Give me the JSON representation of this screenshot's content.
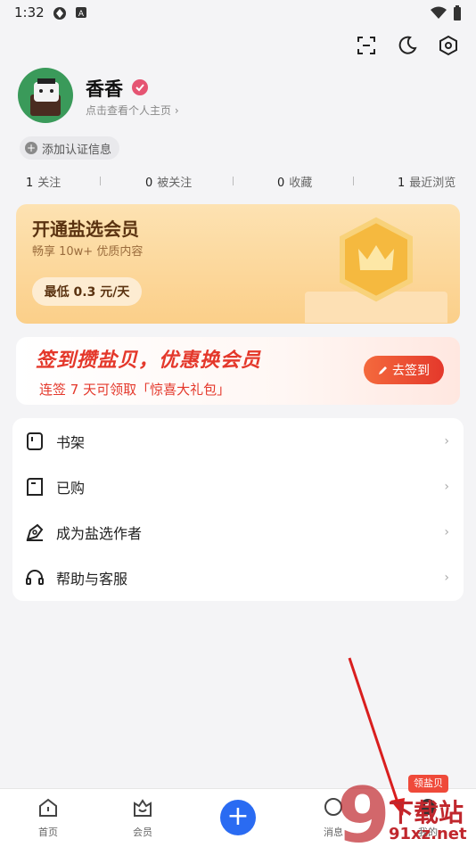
{
  "status_bar": {
    "time": "1:32"
  },
  "top_icons": [
    "scan-icon",
    "moon-icon",
    "settings-icon"
  ],
  "profile": {
    "name": "香香",
    "link_text": "点击查看个人主页 ›",
    "add_cert": "添加认证信息"
  },
  "stats": [
    {
      "num": "1",
      "label": "关注"
    },
    {
      "num": "0",
      "label": "被关注"
    },
    {
      "num": "0",
      "label": "收藏"
    },
    {
      "num": "1",
      "label": "最近浏览"
    }
  ],
  "vip": {
    "title": "开通盐选会员",
    "subtitle": "畅享 10w+ 优质内容",
    "button": "最低 0.3 元/天"
  },
  "checkin": {
    "title": "签到攒盐贝，优惠换会员",
    "subtitle": "连签 7 天可领取「惊喜大礼包」",
    "button": "去签到"
  },
  "menu": [
    {
      "label": "书架",
      "icon": "bookshelf-icon"
    },
    {
      "label": "已购",
      "icon": "purchased-icon"
    },
    {
      "label": "成为盐选作者",
      "icon": "pen-icon"
    },
    {
      "label": "帮助与客服",
      "icon": "headset-icon"
    }
  ],
  "tabbar": {
    "tabs": [
      {
        "label": "首页",
        "icon": "home-icon"
      },
      {
        "label": "会员",
        "icon": "vip-icon"
      },
      {
        "label": "消息",
        "icon": "message-icon"
      },
      {
        "label": "我的",
        "icon": "profile-icon"
      }
    ],
    "badge": "领盐贝"
  },
  "watermark": {
    "line1": "下载站",
    "line2": "91xz.net"
  },
  "colors": {
    "accent_blue": "#2a6bf2",
    "accent_red": "#e4382b",
    "vip_gold": "#fbcf89"
  }
}
